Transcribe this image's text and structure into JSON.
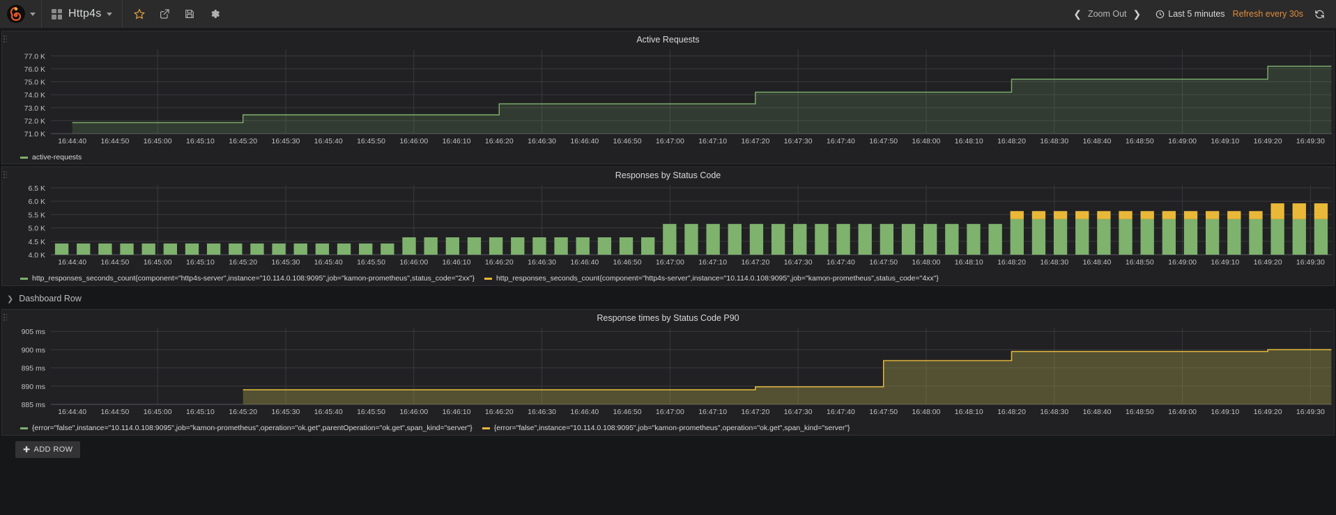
{
  "navbar": {
    "logo_icon": "grafana-logo-icon",
    "logo_caret_icon": "chevron-down-icon",
    "dashboard_grid_icon": "dashboard-grid-icon",
    "dashboard_title": "Http4s",
    "dashboard_caret_icon": "chevron-down-icon",
    "tools": [
      {
        "name": "star-icon",
        "label": "Mark as favorite"
      },
      {
        "name": "share-icon",
        "label": "Share dashboard"
      },
      {
        "name": "save-icon",
        "label": "Save dashboard"
      },
      {
        "name": "settings-gear-icon",
        "label": "Dashboard settings"
      }
    ],
    "zoom_out_prev_icon": "chevron-left-icon",
    "zoom_out_label": "Zoom Out",
    "zoom_out_next_icon": "chevron-right-icon",
    "clock_icon": "clock-icon",
    "time_range": "Last 5 minutes",
    "refresh_interval": "Refresh every 30s",
    "refresh_icon": "refresh-icon",
    "accent_color": "#e08c3d"
  },
  "colors": {
    "series_green": "#7eb26d",
    "series_orange": "#eab839",
    "panel_bg": "#212124",
    "page_bg": "#161719",
    "grid": "#3a3a3d",
    "text": "#d8d9da"
  },
  "x_axis_ticks": [
    "16:44:40",
    "16:44:50",
    "16:45:00",
    "16:45:10",
    "16:45:20",
    "16:45:30",
    "16:45:40",
    "16:45:50",
    "16:46:00",
    "16:46:10",
    "16:46:20",
    "16:46:30",
    "16:46:40",
    "16:46:50",
    "16:47:00",
    "16:47:10",
    "16:47:20",
    "16:47:30",
    "16:47:40",
    "16:47:50",
    "16:48:00",
    "16:48:10",
    "16:48:20",
    "16:48:30",
    "16:48:40",
    "16:48:50",
    "16:49:00",
    "16:49:10",
    "16:49:20",
    "16:49:30"
  ],
  "row": {
    "chevron_icon": "chevron-right-icon",
    "title": "Dashboard Row"
  },
  "footer": {
    "add_row_plus_icon": "plus-icon",
    "add_row_label": "ADD ROW"
  },
  "chart_data": [
    {
      "type": "area",
      "title": "Active Requests",
      "xlabel": "",
      "ylabel": "",
      "ylim": [
        71000,
        77500
      ],
      "y_ticks": [
        71000,
        72000,
        73000,
        74000,
        75000,
        76000,
        77000
      ],
      "y_tick_labels": [
        "71.0 K",
        "72.0 K",
        "73.0 K",
        "74.0 K",
        "75.0 K",
        "76.0 K",
        "77.0 K"
      ],
      "grid": true,
      "legend_position": "bottom-left",
      "series": [
        {
          "name": "active-requests",
          "color": "#7eb26d",
          "x": [
            "16:44:40",
            "16:44:50",
            "16:45:00",
            "16:45:10",
            "16:45:20",
            "16:45:30",
            "16:45:40",
            "16:45:50",
            "16:46:00",
            "16:46:10",
            "16:46:20",
            "16:46:30",
            "16:46:40",
            "16:46:50",
            "16:47:00",
            "16:47:10",
            "16:47:20",
            "16:47:30",
            "16:47:40",
            "16:47:50",
            "16:48:00",
            "16:48:10",
            "16:48:20",
            "16:48:30",
            "16:48:40",
            "16:48:50",
            "16:49:00",
            "16:49:10",
            "16:49:20",
            "16:49:30"
          ],
          "values": [
            71850,
            71850,
            71850,
            71850,
            72450,
            72450,
            72450,
            72450,
            72450,
            72450,
            73300,
            73300,
            73300,
            73300,
            73300,
            73300,
            74200,
            74200,
            74200,
            74200,
            74200,
            74200,
            75200,
            75200,
            75200,
            75200,
            75200,
            75200,
            76200,
            76200
          ]
        }
      ]
    },
    {
      "type": "bar",
      "title": "Responses by Status Code",
      "xlabel": "",
      "ylabel": "",
      "ylim": [
        4000,
        6600
      ],
      "y_ticks": [
        4000,
        4500,
        5000,
        5500,
        6000,
        6500
      ],
      "y_tick_labels": [
        "4.0 K",
        "4.5 K",
        "5.0 K",
        "5.5 K",
        "6.0 K",
        "6.5 K"
      ],
      "grid": true,
      "stacked": true,
      "legend_position": "bottom-left",
      "categories": [
        "16:44:40",
        "16:44:45",
        "16:44:50",
        "16:44:55",
        "16:45:00",
        "16:45:05",
        "16:45:10",
        "16:45:15",
        "16:45:20",
        "16:45:25",
        "16:45:30",
        "16:45:35",
        "16:45:40",
        "16:45:45",
        "16:45:50",
        "16:45:55",
        "16:46:00",
        "16:46:05",
        "16:46:10",
        "16:46:15",
        "16:46:20",
        "16:46:25",
        "16:46:30",
        "16:46:35",
        "16:46:40",
        "16:46:45",
        "16:46:50",
        "16:46:55",
        "16:47:00",
        "16:47:05",
        "16:47:10",
        "16:47:15",
        "16:47:20",
        "16:47:25",
        "16:47:30",
        "16:47:35",
        "16:47:40",
        "16:47:45",
        "16:47:50",
        "16:47:55",
        "16:48:00",
        "16:48:05",
        "16:48:10",
        "16:48:15",
        "16:48:20",
        "16:48:25",
        "16:48:30",
        "16:48:35",
        "16:48:40",
        "16:48:45",
        "16:48:50",
        "16:48:55",
        "16:49:00",
        "16:49:05",
        "16:49:10",
        "16:49:15",
        "16:49:20",
        "16:49:25",
        "16:49:30"
      ],
      "series": [
        {
          "name": "http_responses_seconds_count{component=\"http4s-server\",instance=\"10.114.0.108:9095\",job=\"kamon-prometheus\",status_code=\"2xx\"}",
          "color": "#7eb26d",
          "values": [
            4420,
            4420,
            4420,
            4420,
            4420,
            4420,
            4420,
            4420,
            4420,
            4420,
            4420,
            4420,
            4420,
            4420,
            4420,
            4420,
            4650,
            4650,
            4650,
            4650,
            4650,
            4650,
            4650,
            4650,
            4650,
            4650,
            4650,
            4650,
            5150,
            5150,
            5150,
            5150,
            5150,
            5150,
            5150,
            5150,
            5150,
            5150,
            5150,
            5150,
            5150,
            5150,
            5150,
            5150,
            5330,
            5330,
            5330,
            5330,
            5330,
            5330,
            5330,
            5330,
            5330,
            5330,
            5330,
            5330,
            5330,
            5330,
            5330
          ]
        },
        {
          "name": "http_responses_seconds_count{component=\"http4s-server\",instance=\"10.114.0.108:9095\",job=\"kamon-prometheus\",status_code=\"4xx\"}",
          "color": "#eab839",
          "values": [
            0,
            0,
            0,
            0,
            0,
            0,
            0,
            0,
            0,
            0,
            0,
            0,
            0,
            0,
            0,
            0,
            0,
            0,
            0,
            0,
            0,
            0,
            0,
            0,
            0,
            0,
            0,
            0,
            0,
            0,
            0,
            0,
            0,
            0,
            0,
            0,
            0,
            0,
            0,
            0,
            0,
            0,
            0,
            0,
            300,
            300,
            300,
            300,
            300,
            300,
            300,
            300,
            300,
            300,
            300,
            300,
            590,
            590,
            590
          ]
        }
      ]
    },
    {
      "type": "area",
      "title": "Response times by Status Code P90",
      "xlabel": "",
      "ylabel": "",
      "ylim": [
        885,
        906
      ],
      "y_ticks": [
        885,
        890,
        895,
        900,
        905
      ],
      "y_tick_labels": [
        "885 ms",
        "890 ms",
        "895 ms",
        "900 ms",
        "905 ms"
      ],
      "grid": true,
      "legend_position": "bottom-left",
      "series": [
        {
          "name": "{error=\"false\",instance=\"10.114.0.108:9095\",job=\"kamon-prometheus\",operation=\"ok.get\",parentOperation=\"ok.get\",span_kind=\"server\"}",
          "color": "#7eb26d",
          "x": [
            "16:45:20",
            "16:45:30",
            "16:45:40",
            "16:45:50",
            "16:46:00",
            "16:46:10",
            "16:46:20",
            "16:46:30",
            "16:46:40",
            "16:46:50",
            "16:47:00",
            "16:47:10",
            "16:47:20",
            "16:47:30",
            "16:47:40",
            "16:47:50",
            "16:48:00",
            "16:48:10",
            "16:48:20",
            "16:48:30",
            "16:48:40",
            "16:48:50",
            "16:49:00",
            "16:49:10",
            "16:49:20",
            "16:49:30"
          ],
          "values": [
            889,
            889,
            889,
            889,
            889,
            889,
            889,
            null,
            null,
            null,
            null,
            null,
            889.8,
            889.8,
            889.8,
            897,
            897,
            897,
            899.5,
            899.5,
            899.5,
            899.5,
            899.5,
            899.5,
            900,
            900
          ]
        },
        {
          "name": "{error=\"false\",instance=\"10.114.0.108:9095\",job=\"kamon-prometheus\",operation=\"ok.get\",span_kind=\"server\"}",
          "color": "#eab839",
          "x": [
            "16:45:20",
            "16:45:30",
            "16:45:40",
            "16:45:50",
            "16:46:00",
            "16:46:10",
            "16:46:20",
            "16:46:30",
            "16:46:40",
            "16:46:50",
            "16:47:00",
            "16:47:10",
            "16:47:20",
            "16:47:30",
            "16:47:40",
            "16:47:50",
            "16:48:00",
            "16:48:10",
            "16:48:20",
            "16:48:30",
            "16:48:40",
            "16:48:50",
            "16:49:00",
            "16:49:10",
            "16:49:20",
            "16:49:30"
          ],
          "values": [
            889,
            889,
            889,
            889,
            889,
            889,
            889,
            null,
            null,
            null,
            null,
            null,
            889.8,
            889.8,
            889.8,
            897,
            897,
            897,
            899.5,
            899.5,
            899.5,
            899.5,
            899.5,
            899.5,
            900,
            900
          ]
        }
      ]
    }
  ]
}
